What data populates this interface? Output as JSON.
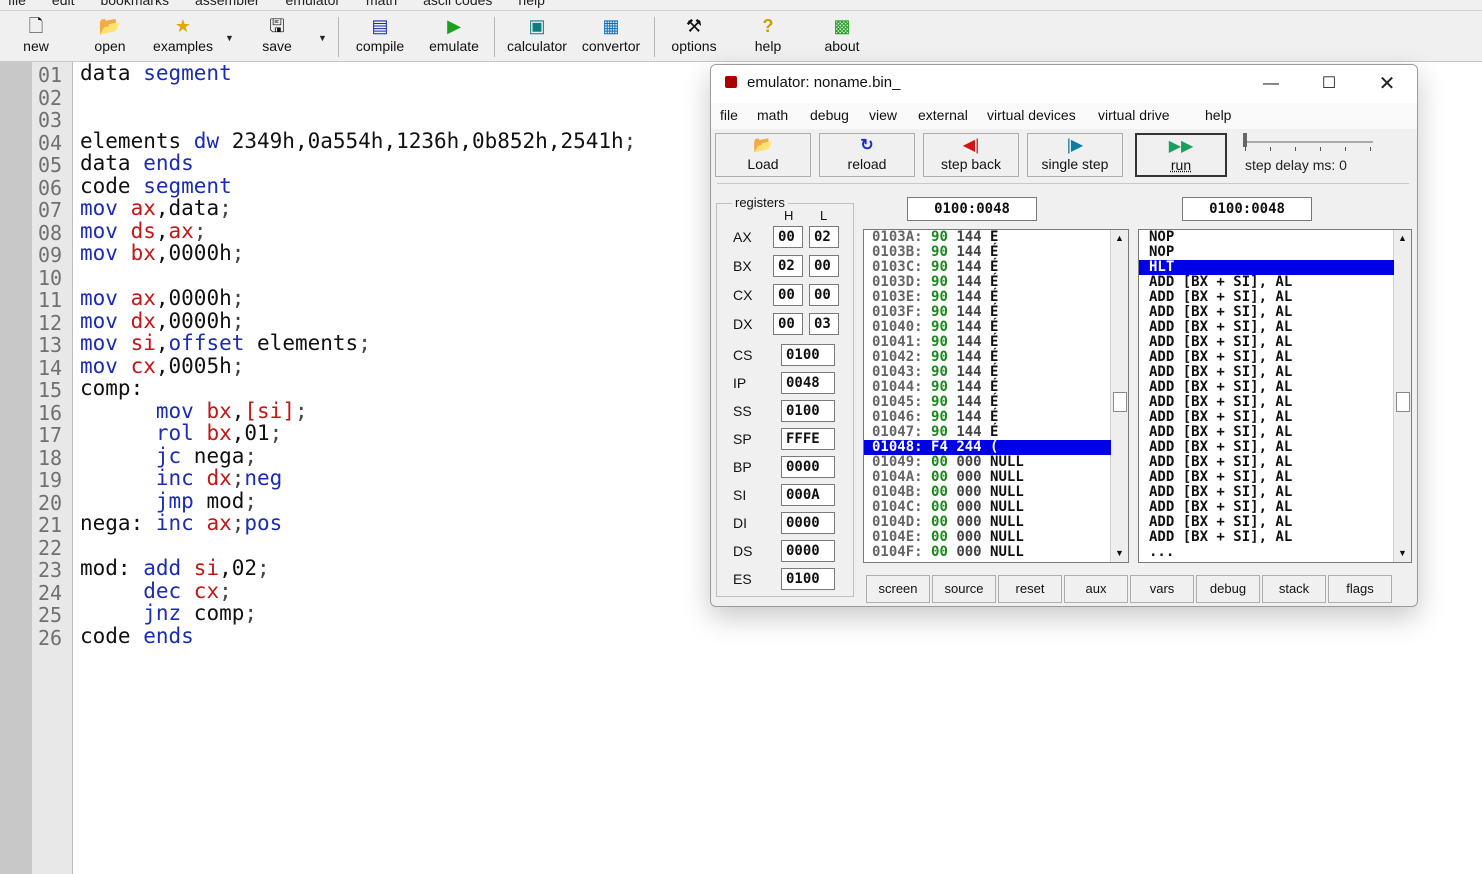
{
  "menubar": [
    "file",
    "edit",
    "bookmarks",
    "assembler",
    "emulator",
    "math",
    "ascii codes",
    "help"
  ],
  "toolbar": {
    "new": "new",
    "open": "open",
    "examples": "examples",
    "save": "save",
    "compile": "compile",
    "emulate": "emulate",
    "calculator": "calculator",
    "convertor": "convertor",
    "options": "options",
    "help": "help",
    "about": "about"
  },
  "editor": {
    "line_numbers": [
      "01",
      "02",
      "03",
      "04",
      "05",
      "06",
      "07",
      "08",
      "09",
      "10",
      "11",
      "12",
      "13",
      "14",
      "15",
      "16",
      "17",
      "18",
      "19",
      "20",
      "21",
      "22",
      "23",
      "24",
      "25",
      "26"
    ],
    "lines": [
      [
        [
          "t",
          "data "
        ],
        [
          "k",
          "segment"
        ]
      ],
      [],
      [],
      [
        [
          "t",
          "elements "
        ],
        [
          "k",
          "dw"
        ],
        [
          "t",
          " 2349h,0a554h,1236h,0b852h,2541h"
        ],
        [
          "p",
          ";"
        ]
      ],
      [
        [
          "t",
          "data "
        ],
        [
          "k",
          "ends"
        ]
      ],
      [
        [
          "t",
          "code "
        ],
        [
          "k",
          "segment"
        ]
      ],
      [
        [
          "k",
          "mov "
        ],
        [
          "r",
          "ax"
        ],
        [
          "t",
          ",data"
        ],
        [
          "p",
          ";"
        ]
      ],
      [
        [
          "k",
          "mov "
        ],
        [
          "r",
          "ds"
        ],
        [
          "t",
          ","
        ],
        [
          "r",
          "ax"
        ],
        [
          "p",
          ";"
        ]
      ],
      [
        [
          "k",
          "mov "
        ],
        [
          "r",
          "bx"
        ],
        [
          "t",
          ",0000h"
        ],
        [
          "p",
          ";"
        ]
      ],
      [],
      [
        [
          "k",
          "mov "
        ],
        [
          "r",
          "ax"
        ],
        [
          "t",
          ",0000h"
        ],
        [
          "p",
          ";"
        ]
      ],
      [
        [
          "k",
          "mov "
        ],
        [
          "r",
          "dx"
        ],
        [
          "t",
          ",0000h"
        ],
        [
          "p",
          ";"
        ]
      ],
      [
        [
          "k",
          "mov "
        ],
        [
          "r",
          "si"
        ],
        [
          "t",
          ","
        ],
        [
          "k",
          "offset"
        ],
        [
          "t",
          " elements"
        ],
        [
          "p",
          ";"
        ]
      ],
      [
        [
          "k",
          "mov "
        ],
        [
          "r",
          "cx"
        ],
        [
          "t",
          ",0005h"
        ],
        [
          "p",
          ";"
        ]
      ],
      [
        [
          "t",
          "comp:"
        ]
      ],
      [
        [
          "t",
          "      "
        ],
        [
          "k",
          "mov "
        ],
        [
          "r",
          "bx"
        ],
        [
          "t",
          ","
        ],
        [
          "r",
          "[si]"
        ],
        [
          "p",
          ";"
        ]
      ],
      [
        [
          "t",
          "      "
        ],
        [
          "k",
          "rol "
        ],
        [
          "r",
          "bx"
        ],
        [
          "t",
          ",01"
        ],
        [
          "p",
          ";"
        ]
      ],
      [
        [
          "t",
          "      "
        ],
        [
          "k",
          "jc"
        ],
        [
          "t",
          " nega"
        ],
        [
          "p",
          ";"
        ]
      ],
      [
        [
          "t",
          "      "
        ],
        [
          "k",
          "inc "
        ],
        [
          "r",
          "dx"
        ],
        [
          "p",
          ";"
        ],
        [
          "k",
          "neg"
        ]
      ],
      [
        [
          "t",
          "      "
        ],
        [
          "k",
          "jmp"
        ],
        [
          "t",
          " mod"
        ],
        [
          "p",
          ";"
        ]
      ],
      [
        [
          "t",
          "nega: "
        ],
        [
          "k",
          "inc "
        ],
        [
          "r",
          "ax"
        ],
        [
          "p",
          ";"
        ],
        [
          "k",
          "pos"
        ]
      ],
      [],
      [
        [
          "t",
          "mod: "
        ],
        [
          "k",
          "add "
        ],
        [
          "r",
          "si"
        ],
        [
          "t",
          ",02"
        ],
        [
          "p",
          ";"
        ]
      ],
      [
        [
          "t",
          "     "
        ],
        [
          "k",
          "dec "
        ],
        [
          "r",
          "cx"
        ],
        [
          "p",
          ";"
        ]
      ],
      [
        [
          "t",
          "     "
        ],
        [
          "k",
          "jnz"
        ],
        [
          "t",
          " comp"
        ],
        [
          "p",
          ";"
        ]
      ],
      [
        [
          "t",
          "code "
        ],
        [
          "k",
          "ends"
        ]
      ]
    ]
  },
  "emulator": {
    "title": "emulator: noname.bin_",
    "menu": [
      "file",
      "math",
      "debug",
      "view",
      "external",
      "virtual devices",
      "virtual drive",
      "help"
    ],
    "buttons": {
      "load": "Load",
      "reload": "reload",
      "step_back": "step back",
      "single_step": "single step",
      "run": "run"
    },
    "step_delay": "step delay ms: 0",
    "registers_title": "registers",
    "col_h": "H",
    "col_l": "L",
    "regs_split": [
      {
        "name": "AX",
        "h": "00",
        "l": "02"
      },
      {
        "name": "BX",
        "h": "02",
        "l": "00"
      },
      {
        "name": "CX",
        "h": "00",
        "l": "00"
      },
      {
        "name": "DX",
        "h": "00",
        "l": "03"
      }
    ],
    "regs_full": [
      {
        "name": "CS",
        "v": "0100"
      },
      {
        "name": "IP",
        "v": "0048"
      },
      {
        "name": "SS",
        "v": "0100"
      },
      {
        "name": "SP",
        "v": "FFFE"
      },
      {
        "name": "BP",
        "v": "0000"
      },
      {
        "name": "SI",
        "v": "000A"
      },
      {
        "name": "DI",
        "v": "0000"
      },
      {
        "name": "DS",
        "v": "0000"
      },
      {
        "name": "ES",
        "v": "0100"
      }
    ],
    "mem_addr": "0100:0048",
    "disasm_addr": "0100:0048",
    "memory": [
      {
        "a": "0103A:",
        "h": "90",
        "d": "144",
        "c": "É"
      },
      {
        "a": "0103B:",
        "h": "90",
        "d": "144",
        "c": "É"
      },
      {
        "a": "0103C:",
        "h": "90",
        "d": "144",
        "c": "É"
      },
      {
        "a": "0103D:",
        "h": "90",
        "d": "144",
        "c": "É"
      },
      {
        "a": "0103E:",
        "h": "90",
        "d": "144",
        "c": "É"
      },
      {
        "a": "0103F:",
        "h": "90",
        "d": "144",
        "c": "É"
      },
      {
        "a": "01040:",
        "h": "90",
        "d": "144",
        "c": "É"
      },
      {
        "a": "01041:",
        "h": "90",
        "d": "144",
        "c": "É"
      },
      {
        "a": "01042:",
        "h": "90",
        "d": "144",
        "c": "É"
      },
      {
        "a": "01043:",
        "h": "90",
        "d": "144",
        "c": "É"
      },
      {
        "a": "01044:",
        "h": "90",
        "d": "144",
        "c": "É"
      },
      {
        "a": "01045:",
        "h": "90",
        "d": "144",
        "c": "É"
      },
      {
        "a": "01046:",
        "h": "90",
        "d": "144",
        "c": "É"
      },
      {
        "a": "01047:",
        "h": "90",
        "d": "144",
        "c": "É"
      },
      {
        "a": "01048:",
        "h": "F4",
        "d": "244",
        "c": "(",
        "sel": true
      },
      {
        "a": "01049:",
        "h": "00",
        "d": "000",
        "c": "NULL"
      },
      {
        "a": "0104A:",
        "h": "00",
        "d": "000",
        "c": "NULL"
      },
      {
        "a": "0104B:",
        "h": "00",
        "d": "000",
        "c": "NULL"
      },
      {
        "a": "0104C:",
        "h": "00",
        "d": "000",
        "c": "NULL"
      },
      {
        "a": "0104D:",
        "h": "00",
        "d": "000",
        "c": "NULL"
      },
      {
        "a": "0104E:",
        "h": "00",
        "d": "000",
        "c": "NULL"
      },
      {
        "a": "0104F:",
        "h": "00",
        "d": "000",
        "c": "NULL"
      }
    ],
    "disasm": [
      {
        "t": "NOP"
      },
      {
        "t": "NOP"
      },
      {
        "t": "HLT",
        "sel": true
      },
      {
        "t": "ADD [BX + SI], AL"
      },
      {
        "t": "ADD [BX + SI], AL"
      },
      {
        "t": "ADD [BX + SI], AL"
      },
      {
        "t": "ADD [BX + SI], AL"
      },
      {
        "t": "ADD [BX + SI], AL"
      },
      {
        "t": "ADD [BX + SI], AL"
      },
      {
        "t": "ADD [BX + SI], AL"
      },
      {
        "t": "ADD [BX + SI], AL"
      },
      {
        "t": "ADD [BX + SI], AL"
      },
      {
        "t": "ADD [BX + SI], AL"
      },
      {
        "t": "ADD [BX + SI], AL"
      },
      {
        "t": "ADD [BX + SI], AL"
      },
      {
        "t": "ADD [BX + SI], AL"
      },
      {
        "t": "ADD [BX + SI], AL"
      },
      {
        "t": "ADD [BX + SI], AL"
      },
      {
        "t": "ADD [BX + SI], AL"
      },
      {
        "t": "ADD [BX + SI], AL"
      },
      {
        "t": "ADD [BX + SI], AL"
      },
      {
        "t": "..."
      }
    ],
    "bottom": [
      "screen",
      "source",
      "reset",
      "aux",
      "vars",
      "debug",
      "stack",
      "flags"
    ]
  },
  "colors": {
    "keyword": "#1a2bb5",
    "register": "#c41515",
    "selection": "#0000e6",
    "hex": "#178a17"
  }
}
